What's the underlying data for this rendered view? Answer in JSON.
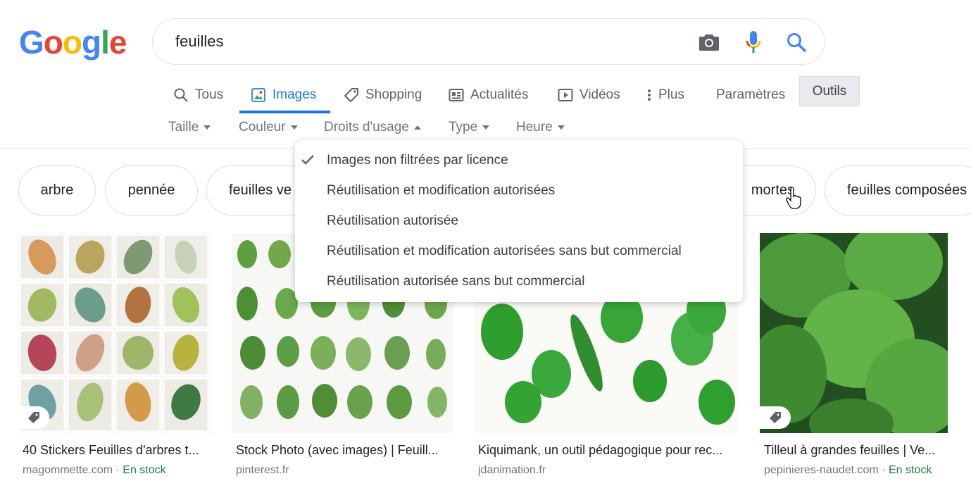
{
  "logo": {
    "letters": [
      "G",
      "o",
      "o",
      "g",
      "l",
      "e"
    ],
    "colors": [
      "#4285f4",
      "#ea4335",
      "#fbbc05",
      "#4285f4",
      "#34a853",
      "#ea4335"
    ]
  },
  "search": {
    "value": "feuilles",
    "icons": [
      "camera-icon",
      "microphone-icon",
      "search-icon"
    ]
  },
  "tabs": [
    {
      "label": "Tous",
      "icon": "search-icon"
    },
    {
      "label": "Images",
      "icon": "image-icon",
      "active": true
    },
    {
      "label": "Shopping",
      "icon": "tag-icon"
    },
    {
      "label": "Actualités",
      "icon": "news-icon"
    },
    {
      "label": "Vidéos",
      "icon": "play-icon"
    },
    {
      "label": "Plus",
      "icon": "more-vert-icon"
    },
    {
      "label": "Paramètres"
    }
  ],
  "tools_label": "Outils",
  "filters": [
    {
      "label": "Taille",
      "caret": "down"
    },
    {
      "label": "Couleur",
      "caret": "down"
    },
    {
      "label": "Droits d'usage",
      "caret": "up"
    },
    {
      "label": "Type",
      "caret": "down"
    },
    {
      "label": "Heure",
      "caret": "down"
    }
  ],
  "chips": [
    "arbre",
    "pennée",
    "feuilles ve",
    "mortes",
    "feuilles composées"
  ],
  "results": [
    {
      "title": "40 Stickers Feuilles d'arbres t...",
      "site": "magommette.com",
      "stock": "En stock"
    },
    {
      "title": "Stock Photo (avec images) | Feuill...",
      "site": "pinterest.fr",
      "stock": ""
    },
    {
      "title": "Kiquimank, un outil pédagogique pour rec...",
      "site": "jdanimation.fr",
      "stock": ""
    },
    {
      "title": "Tilleul à grandes feuilles | Ve...",
      "site": "pepinieres-naudet.com",
      "stock": "En stock"
    }
  ],
  "stock_separator": " · ",
  "usage_rights_menu": {
    "selected_index": 0,
    "items": [
      "Images non filtrées par licence",
      "Réutilisation et modification autorisées",
      "Réutilisation autorisée",
      "Réutilisation et modification autorisées sans but commercial",
      "Réutilisation autorisée sans but commercial"
    ]
  },
  "colors": {
    "accent": "#1a73e8",
    "stock_green": "#188038",
    "leaf_green": "#2e9e2e"
  }
}
